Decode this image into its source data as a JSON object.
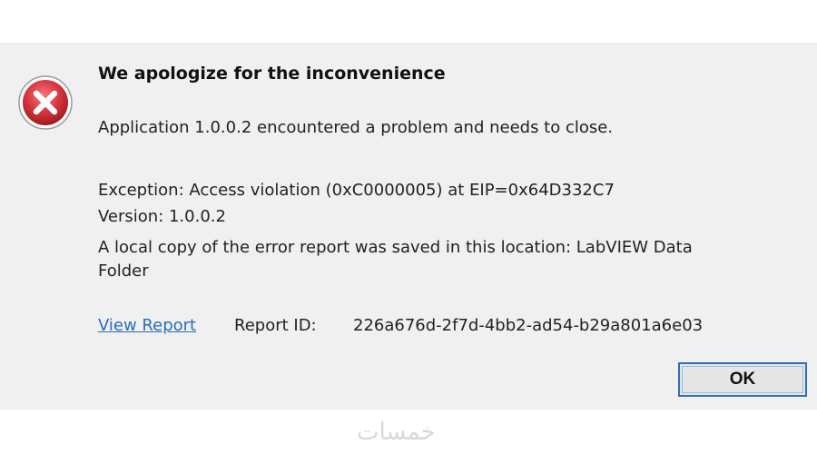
{
  "dialog": {
    "title": "We apologize for the inconvenience",
    "problem": "Application 1.0.0.2 encountered a problem and needs to close.",
    "exception": "Exception: Access violation (0xC0000005) at EIP=0x64D332C7",
    "version": "Version: 1.0.0.2",
    "saved_location": "A local copy of the error report was saved in this location: LabVIEW Data Folder",
    "view_report_link": "View Report",
    "report_id_label": "Report ID:",
    "report_id_value": "226a676d-2f7d-4bb2-ad54-b29a801a6e03",
    "ok_label": "OK"
  },
  "watermark": {
    "text": "خمسات"
  },
  "icon": {
    "name": "error-icon",
    "color": "#d9363e"
  },
  "colors": {
    "dialog_background": "#f0f0f0",
    "link": "#2a6cc0",
    "button_border": "#2f6fb4"
  }
}
